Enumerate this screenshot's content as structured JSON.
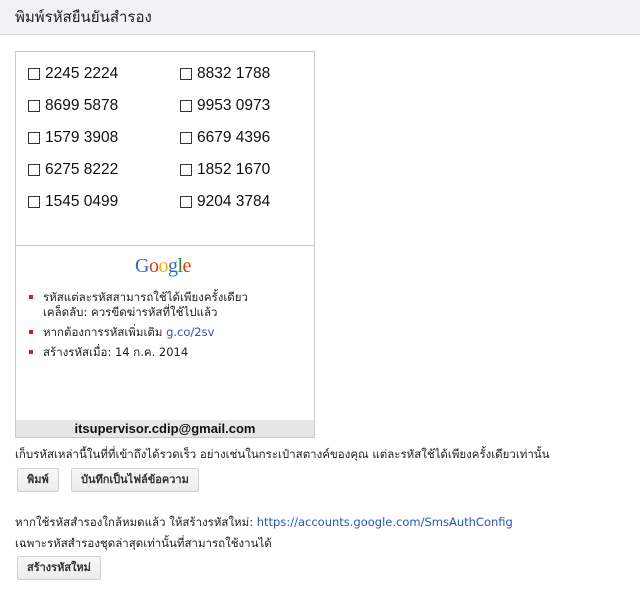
{
  "header": {
    "title": "พิมพ์รหัสยืนยันสำรอง"
  },
  "codes": [
    "2245 2224",
    "8832 1788",
    "8699 5878",
    "9953 0973",
    "1579 3908",
    "6679 4396",
    "6275 8222",
    "1852 1670",
    "1545 0499",
    "9204 3784"
  ],
  "card": {
    "logo_letters": [
      "G",
      "o",
      "o",
      "g",
      "l",
      "e"
    ],
    "logo_colors": [
      "#3366cc",
      "#dc3912",
      "#f5b400",
      "#3366cc",
      "#109618",
      "#dc3912"
    ],
    "bullet_color": "#d91a1a",
    "bullets": {
      "b1_line1": "รหัสแต่ละรหัสสามารถใช้ได้เพียงครั้งเดียว",
      "b1_line2": "เคล็ดลับ: ควรขีดฆ่ารหัสที่ใช้ไปแล้ว",
      "b2_text": "หากต้องการรหัสเพิ่มเติม",
      "b2_link": "g.co/2sv",
      "b3_text": "สร้างรหัสเมื่อ: 14 ก.ค. 2014"
    },
    "email": "itsupervisor.cdip@gmail.com"
  },
  "notice": "เก็บรหัสเหล่านี้ในที่ที่เข้าถึงได้รวดเร็ว อย่างเช่นในกระเป๋าสตางค์ของคุณ แต่ละรหัสใช้ได้เพียงครั้งเดียวเท่านั้น",
  "buttons": {
    "print": "พิมพ์",
    "save_text": "บันทึกเป็นไฟล์ข้อความ",
    "generate": "สร้างรหัสใหม่"
  },
  "regen": {
    "text": "หากใช้รหัสสำรองใกล้หมดแล้ว ให้สร้างรหัสใหม่:",
    "link": "https://accounts.google.com/SmsAuthConfig",
    "note": "เฉพาะรหัสสำรองชุดล่าสุดเท่านั้นที่สามารถใช้งานได้"
  },
  "colors": {
    "link": "#2a55b9",
    "header_bg": "#f1f1f6"
  }
}
